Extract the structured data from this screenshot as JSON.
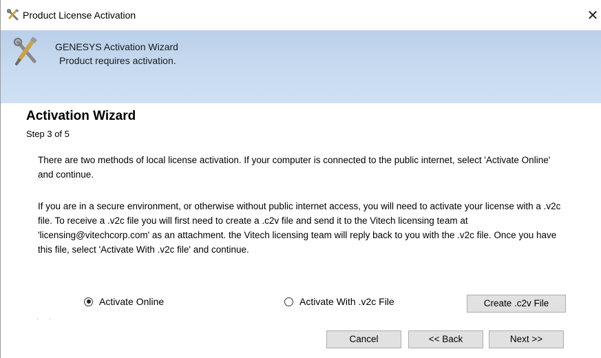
{
  "window": {
    "title": "Product License Activation",
    "close_glyph": "✕"
  },
  "banner": {
    "title": "GENESYS Activation Wizard",
    "subtitle": "Product requires activation."
  },
  "wizard": {
    "heading": "Activation Wizard",
    "step": "Step 3 of 5",
    "paragraph1": "There are two methods of local license activation.  If your computer is connected to the public internet, select 'Activate Online' and continue.",
    "paragraph2": "If you are in a secure environment, or otherwise without public internet access, you will need to activate your license with a .v2c file.  To receive a .v2c file you will first need to create a .c2v file and send it to the Vitech licensing team at 'licensing@vitechcorp.com' as an attachment. the Vitech licensing team will reply back to you with the .v2c file.  Once you have this file, select 'Activate With .v2c file' and continue."
  },
  "options": {
    "online_label": "Activate Online",
    "online_selected": true,
    "v2c_label": "Activate With .v2c File",
    "v2c_selected": false
  },
  "buttons": {
    "create_c2v": "Create .c2v File",
    "cancel": "Cancel",
    "back": "<< Back",
    "next": "Next >>"
  },
  "icons": {
    "title_icon": "tools-icon",
    "banner_icon": "tools-icon",
    "close_icon": "close-icon"
  }
}
